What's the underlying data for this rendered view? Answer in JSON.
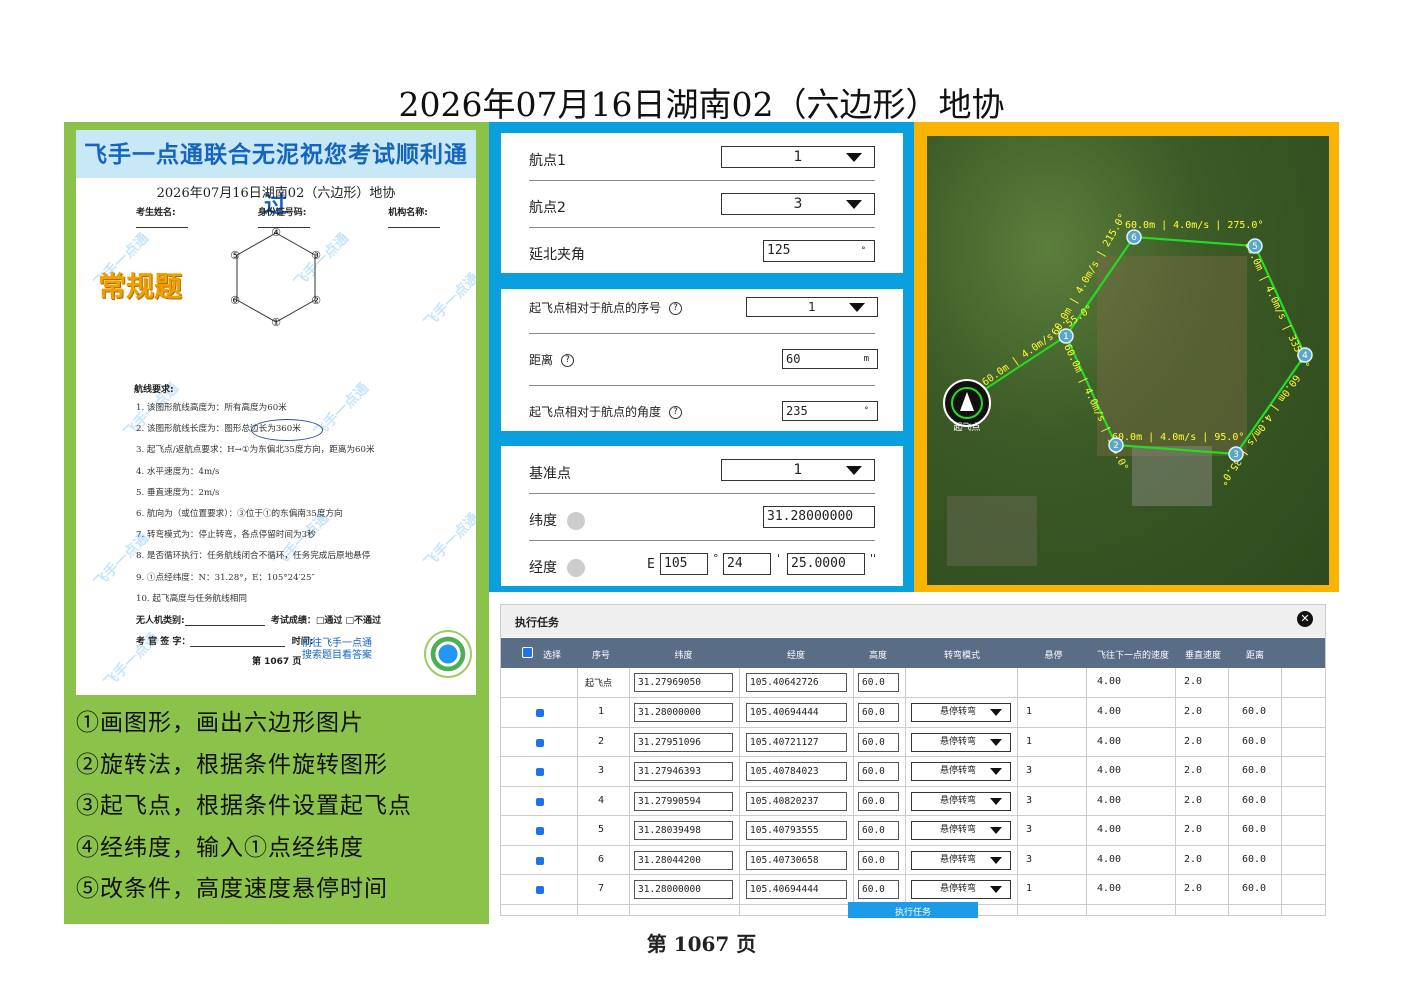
{
  "title": "2026年07月16日湖南02（六边形）地协",
  "paper": {
    "banner": "飞手一点通联合无泥祝您考试顺利通过",
    "title": "2026年07月16日湖南02（六边形）地协",
    "fields": [
      "考生姓名:",
      "身份证号码:",
      "机构名称:"
    ],
    "stamp": "常规题",
    "hexagon_labels": [
      "④",
      "③",
      "②",
      "①",
      "⑥",
      "⑤"
    ],
    "req_title": "航线要求:",
    "requirements": [
      "1.  该图形航线高度为：所有高度为60米",
      "2.  该图形航线长度为：图形总边长为360米",
      "3.  起飞点/返航点要求：H→①为东偏北35度方向，距离为60米",
      "4.  水平速度为：4m/s",
      "5.  垂直速度为：2m/s",
      "6.  航向为（或位置要求）：③位于①的东偏南35度方向",
      "7.  转弯模式为：停止转弯，各点停留时间为3秒",
      "8.  是否循环执行：任务航线闭合不循环，任务完成后原地悬停",
      "9.  ①点经纬度：N：31.28°，E：105°24′25″",
      "10. 起飞高度与任务航线相同"
    ],
    "foot_type": "无人机类别:",
    "foot_result": "考试成绩：□通过  □不通过",
    "foot_sign": "考 官 签 字：",
    "foot_time": "时间:",
    "page": "第  1067  页",
    "promo": [
      "前往飞手一点通",
      "搜索题目看答案"
    ],
    "watermark": "飞手一点通"
  },
  "steps": [
    "①画图形，画出六边形图片",
    "②旋转法，根据条件旋转图形",
    "③起飞点，根据条件设置起飞点",
    "④经纬度，输入①点经纬度",
    "⑤改条件，高度速度悬停时间"
  ],
  "form1": {
    "wp1_label": "航点1",
    "wp1_value": "1",
    "wp2_label": "航点2",
    "wp2_value": "3",
    "angle_label": "延北夹角",
    "angle_value": "125",
    "angle_unit": "°"
  },
  "form2": {
    "seq_label": "起飞点相对于航点的序号",
    "seq_value": "1",
    "dist_label": "距离",
    "dist_value": "60",
    "dist_unit": "m",
    "ang_label": "起飞点相对于航点的角度",
    "ang_value": "235",
    "ang_unit": "°"
  },
  "form3": {
    "base_label": "基准点",
    "base_value": "1",
    "lat_label": "纬度",
    "lat_value": "31.28000000",
    "lon_label": "经度",
    "lon_prefix": "E",
    "lon_deg": "105",
    "lon_min": "24",
    "lon_sec": "25.0000",
    "deg_sym": "°",
    "min_sym": "'",
    "sec_sym": "''"
  },
  "map": {
    "takeoff_label": "起飞点",
    "waypoints": [
      "1",
      "2",
      "3",
      "4",
      "5",
      "6"
    ],
    "segments": [
      "60.0m | 4.0m/s | 275.0°",
      "60.0m | 4.0m/s | 335.0°",
      "60.0m | 4.0m/s | 35.0°",
      "60.0m | 4.0m/s | 95.0°",
      "60.0m | 4.0m/s | 155.0°",
      "60.0m | 4.0m/s | 215.0°"
    ],
    "takeoff_segment": "60.0m | 4.0m/s | 55.0°"
  },
  "task": {
    "title": "执行任务",
    "close": "✕",
    "headers": [
      "选择",
      "序号",
      "纬度",
      "经度",
      "高度",
      "转弯模式",
      "悬停",
      "飞往下一点的速度",
      "垂直速度",
      "距离"
    ],
    "rows": [
      {
        "seq": "起飞点",
        "lat": "31.27969050",
        "lon": "105.40642726",
        "alt": "60.0",
        "turn": "",
        "hover": "",
        "speed": "4.00",
        "vspeed": "2.0",
        "dist": ""
      },
      {
        "seq": "1",
        "lat": "31.28000000",
        "lon": "105.40694444",
        "alt": "60.0",
        "turn": "悬停转弯",
        "hover": "1",
        "speed": "4.00",
        "vspeed": "2.0",
        "dist": "60.0"
      },
      {
        "seq": "2",
        "lat": "31.27951096",
        "lon": "105.40721127",
        "alt": "60.0",
        "turn": "悬停转弯",
        "hover": "1",
        "speed": "4.00",
        "vspeed": "2.0",
        "dist": "60.0"
      },
      {
        "seq": "3",
        "lat": "31.27946393",
        "lon": "105.40784023",
        "alt": "60.0",
        "turn": "悬停转弯",
        "hover": "3",
        "speed": "4.00",
        "vspeed": "2.0",
        "dist": "60.0"
      },
      {
        "seq": "4",
        "lat": "31.27990594",
        "lon": "105.40820237",
        "alt": "60.0",
        "turn": "悬停转弯",
        "hover": "3",
        "speed": "4.00",
        "vspeed": "2.0",
        "dist": "60.0"
      },
      {
        "seq": "5",
        "lat": "31.28039498",
        "lon": "105.40793555",
        "alt": "60.0",
        "turn": "悬停转弯",
        "hover": "3",
        "speed": "4.00",
        "vspeed": "2.0",
        "dist": "60.0"
      },
      {
        "seq": "6",
        "lat": "31.28044200",
        "lon": "105.40730658",
        "alt": "60.0",
        "turn": "悬停转弯",
        "hover": "3",
        "speed": "4.00",
        "vspeed": "2.0",
        "dist": "60.0"
      },
      {
        "seq": "7",
        "lat": "31.28000000",
        "lon": "105.40694444",
        "alt": "60.0",
        "turn": "悬停转弯",
        "hover": "1",
        "speed": "4.00",
        "vspeed": "2.0",
        "dist": "60.0"
      }
    ],
    "exec_button": "执行任务"
  },
  "page_number": "第 1067 页",
  "colors": {
    "left_panel": "#8bc34a",
    "blue_panel": "#0aa0e0",
    "yellow_panel": "#f8b400",
    "route": "#22dd22",
    "label": "#ffff33"
  }
}
